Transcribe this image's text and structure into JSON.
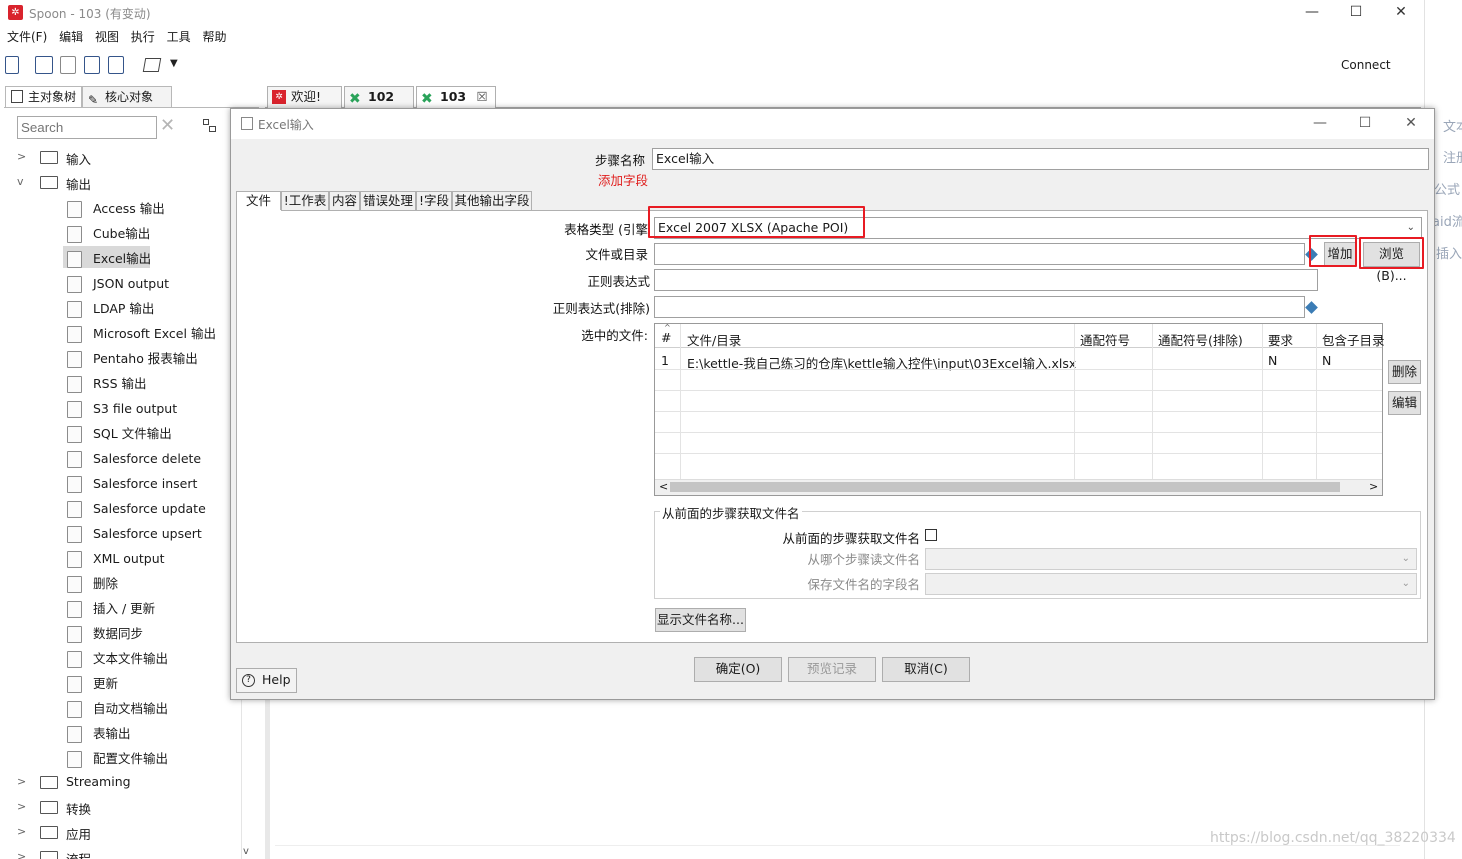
{
  "window": {
    "title": "Spoon - 103 (有变动)",
    "minimize": "—",
    "maximize": "☐",
    "close": "✕"
  },
  "menu": [
    "文件(F)",
    "编辑",
    "视图",
    "执行",
    "工具",
    "帮助"
  ],
  "toolbar": {
    "connect_label": "Connect"
  },
  "right_strip": [
    "文本",
    "注册",
    "公式",
    "aid流",
    "插入类"
  ],
  "left_panel": {
    "tabs": [
      "主对象树",
      "核心对象"
    ],
    "search_placeholder": "Search",
    "tree": {
      "input_label": "输入",
      "output_label": "输出",
      "output_items": [
        "Access 输出",
        "Cube输出",
        "Excel输出",
        "JSON output",
        "LDAP 输出",
        "Microsoft Excel 输出",
        "Pentaho 报表输出",
        "RSS 输出",
        "S3 file output",
        "SQL 文件输出",
        "Salesforce delete",
        "Salesforce insert",
        "Salesforce update",
        "Salesforce upsert",
        "XML output",
        "删除",
        "插入 / 更新",
        "数据同步",
        "文本文件输出",
        "更新",
        "自动文档输出",
        "表输出",
        "配置文件输出"
      ],
      "bottom_categories": [
        "Streaming",
        "转换",
        "应用",
        "流程"
      ],
      "selected": "Excel输出"
    }
  },
  "doc_tabs": [
    "欢迎!",
    "102",
    "103"
  ],
  "dialog": {
    "title": "Excel输入",
    "step_name_label": "步骤名称",
    "step_name_value": "Excel输入",
    "add_field_label": "添加字段",
    "tabs": [
      "文件",
      "!工作表",
      "内容",
      "错误处理",
      "!字段",
      "其他输出字段"
    ],
    "table_type_label": "表格类型 (引擎",
    "table_type_value": "Excel 2007 XLSX (Apache POI)",
    "file_or_dir_label": "文件或目录",
    "file_or_dir_value": "",
    "add_button": "增加",
    "browse_button": "浏览(B)...",
    "regex_label": "正则表达式",
    "regex_exclude_label": "正则表达式(排除)",
    "selected_files_label": "选中的文件:",
    "grid": {
      "columns": [
        "#",
        "文件/目录",
        "通配符号",
        "通配符号(排除)",
        "要求",
        "包含子目录"
      ],
      "rows": [
        [
          "1",
          "E:\\kettle-我自己练习的仓库\\kettle输入控件\\input\\03Excel输入.xlsx",
          "",
          "",
          "N",
          "N"
        ]
      ]
    },
    "delete_button": "删除",
    "edit_button": "编辑",
    "group_title": "从前面的步骤获取文件名",
    "accept_from_prev_label": "从前面的步骤获取文件名",
    "read_from_step_label": "从哪个步骤读文件名",
    "save_field_label": "保存文件名的字段名",
    "show_files_button": "显示文件名称...",
    "help_button": "Help",
    "ok_button": "确定(O)",
    "preview_button": "预览记录",
    "cancel_button": "取消(C)"
  },
  "watermark": "https://blog.csdn.net/qq_38220334"
}
